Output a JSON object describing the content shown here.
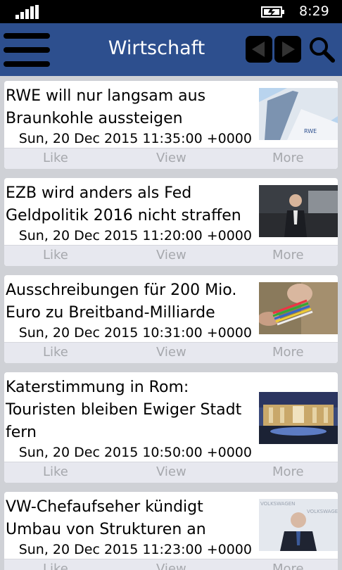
{
  "status": {
    "time": "8:29",
    "signal_icon": "signal-bars-icon",
    "battery_icon": "battery-charging-icon"
  },
  "header": {
    "title": "Wirtschaft",
    "accent": "#2d4f8e",
    "menu_icon": "hamburger-menu-icon",
    "prev_icon": "arrow-left-icon",
    "next_icon": "arrow-right-icon",
    "search_icon": "search-icon"
  },
  "actions": {
    "like": "Like",
    "view": "View",
    "more": "More"
  },
  "articles": [
    {
      "title": "RWE will nur langsam aus\nBraunkohle aussteigen",
      "date": "Sun, 20 Dec 2015 11:35:00 +0000"
    },
    {
      "title": "EZB wird anders als Fed\nGeldpolitik 2016 nicht straffen",
      "date": "Sun, 20 Dec 2015 11:20:00 +0000"
    },
    {
      "title": "Ausschreibungen für 200 Mio.\nEuro zu Breitband-Milliarde",
      "date": "Sun, 20 Dec 2015 10:31:00 +0000"
    },
    {
      "title": "Katerstimmung in Rom:\nTouristen bleiben Ewiger Stadt\nfern",
      "date": "Sun, 20 Dec 2015 10:50:00 +0000"
    },
    {
      "title": "VW-Chefaufseher kündigt\nUmbau von Strukturen an",
      "date": "Sun, 20 Dec 2015 11:23:00 +0000"
    }
  ]
}
